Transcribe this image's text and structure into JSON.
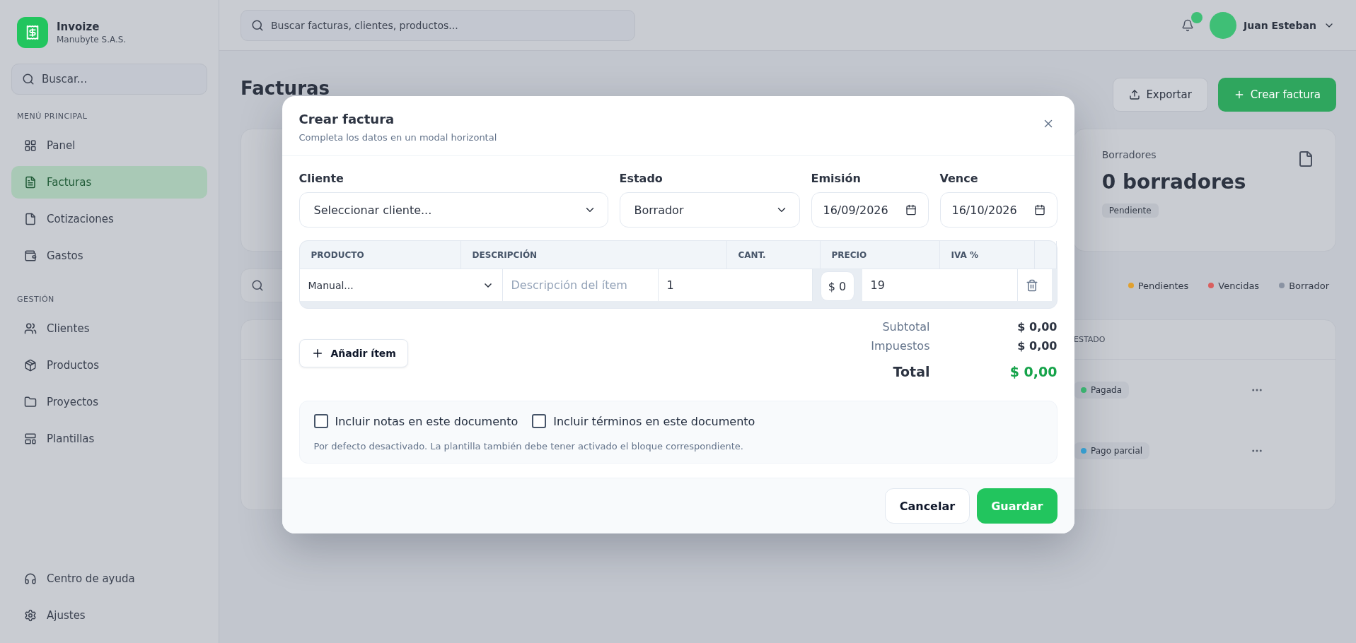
{
  "sidebar": {
    "brand": {
      "name": "Invoize",
      "company": "Manubyte S.A.S."
    },
    "search": {
      "placeholder": "Buscar..."
    },
    "sections": [
      {
        "title": "MENÚ PRINCIPAL",
        "items": [
          {
            "label": "Panel",
            "selected": false
          },
          {
            "label": "Facturas",
            "selected": true
          },
          {
            "label": "Cotizaciones",
            "selected": false
          },
          {
            "label": "Gastos",
            "selected": false
          }
        ]
      },
      {
        "title": "GESTIÓN",
        "items": [
          {
            "label": "Clientes",
            "selected": false
          },
          {
            "label": "Productos",
            "selected": false
          },
          {
            "label": "Proyectos",
            "selected": false
          },
          {
            "label": "Plantillas",
            "selected": false
          }
        ]
      }
    ],
    "footer_items": [
      "Centro de ayuda",
      "Ajustes"
    ]
  },
  "topbar": {
    "search": {
      "placeholder": "Buscar facturas, clientes, productos..."
    },
    "user": {
      "name": "Juan Esteban"
    }
  },
  "page": {
    "title": "Facturas",
    "actions": [
      {
        "label": "Exportar",
        "kind": "secondary"
      },
      {
        "label": "Crear factura",
        "kind": "primary"
      }
    ]
  },
  "stats": [
    {
      "label": "Borradores",
      "value": "0 borradores",
      "badge": "Pendiente"
    }
  ],
  "filters": [
    {
      "label": "Pendientes",
      "color": "#e0a030"
    },
    {
      "label": "Vencidas",
      "color": "#d95f5f"
    },
    {
      "label": "Borrador",
      "color": "#8a93a3"
    }
  ],
  "table": {
    "columns": [
      "ESTADO"
    ],
    "rows": [
      {
        "status": "Pagada",
        "color": "#3fbf76"
      },
      {
        "status": "Pago parcial",
        "color": "#3aa8dc"
      }
    ]
  },
  "modal": {
    "title": "Crear factura",
    "subtitle": "Completa los datos en un modal horizontal",
    "fields": [
      {
        "label": "Cliente",
        "kind": "select",
        "value": "Seleccionar cliente..."
      },
      {
        "label": "Estado",
        "kind": "select",
        "value": "Borrador"
      },
      {
        "label": "Emisión",
        "kind": "date",
        "value": "16/09/2026"
      },
      {
        "label": "Vence",
        "kind": "date",
        "value": "16/10/2026"
      }
    ],
    "items_table": {
      "columns": [
        "PRODUCTO",
        "DESCRIPCIÓN",
        "CANT.",
        "PRECIO",
        "IVA %"
      ],
      "rows": [
        {
          "product": "Manual...",
          "description_placeholder": "Descripción del ítem",
          "quantity": "1",
          "price": "$ 0",
          "tax": "19"
        }
      ]
    },
    "add_button": "Añadir ítem",
    "totals": [
      {
        "label": "Subtotal",
        "value": "$ 0,00",
        "kind": "line"
      },
      {
        "label": "Impuestos",
        "value": "$ 0,00",
        "kind": "line"
      },
      {
        "label": "Total",
        "value": "$ 0,00",
        "kind": "grand"
      }
    ],
    "options": [
      {
        "label": "Incluir notas en este documento",
        "checked": false
      },
      {
        "label": "Incluir términos en este documento",
        "checked": false
      }
    ],
    "note": "Por defecto desactivado. La plantilla también debe tener activado el bloque correspondiente.",
    "buttons": [
      {
        "label": "Cancelar",
        "kind": "secondary"
      },
      {
        "label": "Guardar",
        "kind": "primary"
      }
    ]
  }
}
